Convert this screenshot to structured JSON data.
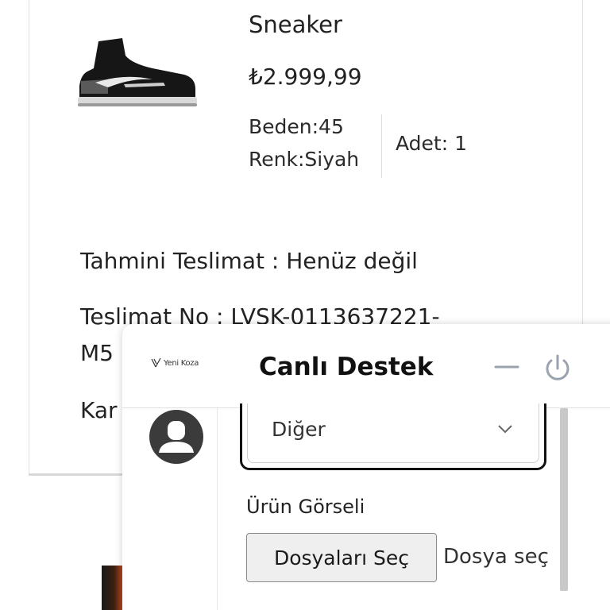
{
  "order": {
    "product_name": "Sneaker",
    "price": "₺2.999,99",
    "size": "Beden:45",
    "color": "Renk:Siyah",
    "quantity": "Adet: 1",
    "estimated_delivery": "Tahmini Teslimat : Henüz değil",
    "delivery_no": "Teslimat No : LVSK-0113637221-",
    "delivery_no_cont": "M5",
    "cargo": "Kar"
  },
  "chat": {
    "logo_text": "Yeni Koza",
    "title": "Canlı Destek",
    "select_value": "Diğer",
    "image_label": "Ürün Görseli",
    "file_button": "Dosyaları Seç",
    "file_status": "Dosya seç"
  },
  "colors": {
    "avatar_bg": "#3b3b3b",
    "icon_gray": "#9aa3ad",
    "focus_border": "#111111"
  },
  "icons": [
    "sneaker-image",
    "avatar-icon",
    "minimize-icon",
    "power-icon",
    "chevron-down-icon",
    "logo-icon"
  ]
}
